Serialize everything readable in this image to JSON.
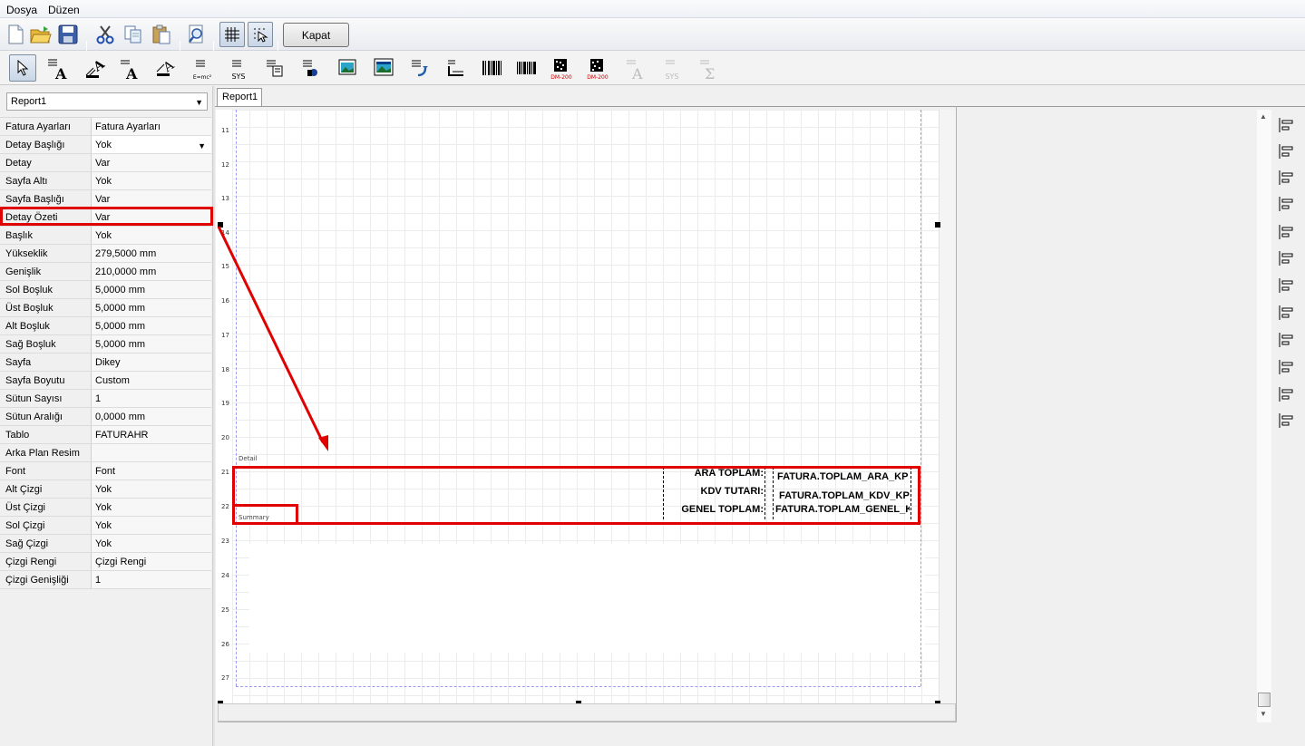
{
  "menu": {
    "file": "Dosya",
    "edit": "Düzen"
  },
  "toolbar": {
    "close_label": "Kapat",
    "icons": [
      "new-document-icon",
      "open-folder-icon",
      "save-icon",
      "cut-icon",
      "copy-icon",
      "paste-icon",
      "preview-icon",
      "grid-icon",
      "snap-icon"
    ]
  },
  "components": {
    "icons": [
      "pointer-icon",
      "label-icon",
      "rotated-label-icon",
      "multiline-label-icon",
      "rotated-field-icon",
      "formula-icon",
      "system-variable-icon",
      "memo-icon",
      "image-field-icon",
      "image-icon",
      "rich-image-icon",
      "subreport-icon",
      "shape-icon",
      "barcode-icon",
      "barcode2-icon",
      "datamatrix-icon",
      "datamatrix2-icon",
      "disabled-label-icon",
      "disabled-system-icon",
      "disabled-sum-icon"
    ],
    "caption_formula": "E=mc²",
    "caption_sys": "SYS",
    "caption_dm1": "DM-200",
    "caption_dm2": "DM-200",
    "caption_sys_disabled": "SYS"
  },
  "left_panel": {
    "report_select": "Report1",
    "properties": [
      {
        "key": "Fatura Ayarları",
        "value": "Fatura Ayarları"
      },
      {
        "key": "Detay Başlığı",
        "value": "Yok"
      },
      {
        "key": "Detay",
        "value": "Var"
      },
      {
        "key": "Sayfa Altı",
        "value": "Yok"
      },
      {
        "key": "Sayfa Başlığı",
        "value": "Var"
      },
      {
        "key": "Detay Özeti",
        "value": "Var"
      },
      {
        "key": "Başlık",
        "value": "Yok"
      },
      {
        "key": "Yükseklik",
        "value": "279,5000 mm"
      },
      {
        "key": "Genişlik",
        "value": "210,0000 mm"
      },
      {
        "key": "Sol Boşluk",
        "value": "5,0000 mm"
      },
      {
        "key": "Üst Boşluk",
        "value": "5,0000 mm"
      },
      {
        "key": "Alt Boşluk",
        "value": "5,0000 mm"
      },
      {
        "key": "Sağ Boşluk",
        "value": "5,0000 mm"
      },
      {
        "key": "Sayfa",
        "value": "Dikey"
      },
      {
        "key": "Sayfa Boyutu",
        "value": "Custom"
      },
      {
        "key": "Sütun Sayısı",
        "value": "1"
      },
      {
        "key": "Sütun Aralığı",
        "value": "0,0000 mm"
      },
      {
        "key": "Tablo",
        "value": "FATURAHR"
      },
      {
        "key": "Arka Plan Resim",
        "value": ""
      },
      {
        "key": "Font",
        "value": "Font"
      },
      {
        "key": "Alt Çizgi",
        "value": "Yok"
      },
      {
        "key": "Üst Çizgi",
        "value": "Yok"
      },
      {
        "key": "Sol Çizgi",
        "value": "Yok"
      },
      {
        "key": "Sağ Çizgi",
        "value": "Yok"
      },
      {
        "key": "Çizgi Rengi",
        "value": "Çizgi Rengi"
      },
      {
        "key": "Çizgi Genişliği",
        "value": "1"
      }
    ]
  },
  "tabs": {
    "report1": "Report1"
  },
  "ruler": {
    "numbers": [
      "11",
      "12",
      "13",
      "14",
      "15",
      "16",
      "17",
      "18",
      "19",
      "20",
      "21",
      "22",
      "23",
      "24",
      "25",
      "26",
      "27"
    ]
  },
  "bands": {
    "detail": "Detail",
    "summary": "Summary"
  },
  "summary_fields": {
    "labels": [
      "ARA TOPLAM:",
      "KDV TUTARI:",
      "GENEL TOPLAM:"
    ],
    "values": [
      "FATURA.TOPLAM_ARA_KP",
      "FATURA.TOPLAM_KDV_KP",
      "FATURA.TOPLAM_GENEL_K"
    ]
  },
  "colors": {
    "highlight": "#e00000",
    "guide": "#9d9df0"
  },
  "align_palette": {
    "icons": [
      "align-left-icon",
      "align-hcenter-icon",
      "align-width-icon",
      "align-top-icon",
      "align-right-icon",
      "space-horizontal-icon",
      "align-bottom-icon",
      "align-vcenter-icon",
      "align-height-icon",
      "move-left-icon",
      "move-down-icon",
      "space-vertical-icon"
    ]
  }
}
